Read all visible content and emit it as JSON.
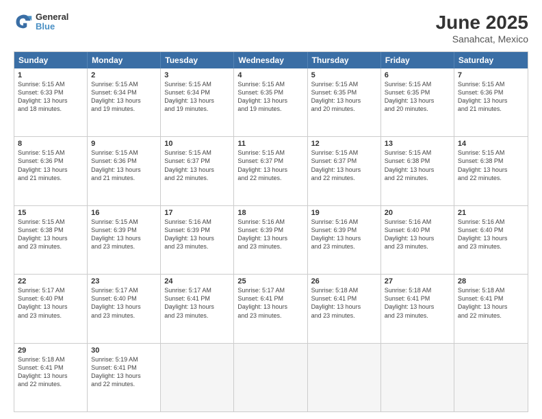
{
  "logo": {
    "line1": "General",
    "line2": "Blue"
  },
  "title": "June 2025",
  "subtitle": "Sanahcat, Mexico",
  "weekdays": [
    "Sunday",
    "Monday",
    "Tuesday",
    "Wednesday",
    "Thursday",
    "Friday",
    "Saturday"
  ],
  "weeks": [
    [
      {
        "day": "1",
        "text": "Sunrise: 5:15 AM\nSunset: 6:33 PM\nDaylight: 13 hours\nand 18 minutes."
      },
      {
        "day": "2",
        "text": "Sunrise: 5:15 AM\nSunset: 6:34 PM\nDaylight: 13 hours\nand 19 minutes."
      },
      {
        "day": "3",
        "text": "Sunrise: 5:15 AM\nSunset: 6:34 PM\nDaylight: 13 hours\nand 19 minutes."
      },
      {
        "day": "4",
        "text": "Sunrise: 5:15 AM\nSunset: 6:35 PM\nDaylight: 13 hours\nand 19 minutes."
      },
      {
        "day": "5",
        "text": "Sunrise: 5:15 AM\nSunset: 6:35 PM\nDaylight: 13 hours\nand 20 minutes."
      },
      {
        "day": "6",
        "text": "Sunrise: 5:15 AM\nSunset: 6:35 PM\nDaylight: 13 hours\nand 20 minutes."
      },
      {
        "day": "7",
        "text": "Sunrise: 5:15 AM\nSunset: 6:36 PM\nDaylight: 13 hours\nand 21 minutes."
      }
    ],
    [
      {
        "day": "8",
        "text": "Sunrise: 5:15 AM\nSunset: 6:36 PM\nDaylight: 13 hours\nand 21 minutes."
      },
      {
        "day": "9",
        "text": "Sunrise: 5:15 AM\nSunset: 6:36 PM\nDaylight: 13 hours\nand 21 minutes."
      },
      {
        "day": "10",
        "text": "Sunrise: 5:15 AM\nSunset: 6:37 PM\nDaylight: 13 hours\nand 22 minutes."
      },
      {
        "day": "11",
        "text": "Sunrise: 5:15 AM\nSunset: 6:37 PM\nDaylight: 13 hours\nand 22 minutes."
      },
      {
        "day": "12",
        "text": "Sunrise: 5:15 AM\nSunset: 6:37 PM\nDaylight: 13 hours\nand 22 minutes."
      },
      {
        "day": "13",
        "text": "Sunrise: 5:15 AM\nSunset: 6:38 PM\nDaylight: 13 hours\nand 22 minutes."
      },
      {
        "day": "14",
        "text": "Sunrise: 5:15 AM\nSunset: 6:38 PM\nDaylight: 13 hours\nand 22 minutes."
      }
    ],
    [
      {
        "day": "15",
        "text": "Sunrise: 5:15 AM\nSunset: 6:38 PM\nDaylight: 13 hours\nand 23 minutes."
      },
      {
        "day": "16",
        "text": "Sunrise: 5:15 AM\nSunset: 6:39 PM\nDaylight: 13 hours\nand 23 minutes."
      },
      {
        "day": "17",
        "text": "Sunrise: 5:16 AM\nSunset: 6:39 PM\nDaylight: 13 hours\nand 23 minutes."
      },
      {
        "day": "18",
        "text": "Sunrise: 5:16 AM\nSunset: 6:39 PM\nDaylight: 13 hours\nand 23 minutes."
      },
      {
        "day": "19",
        "text": "Sunrise: 5:16 AM\nSunset: 6:39 PM\nDaylight: 13 hours\nand 23 minutes."
      },
      {
        "day": "20",
        "text": "Sunrise: 5:16 AM\nSunset: 6:40 PM\nDaylight: 13 hours\nand 23 minutes."
      },
      {
        "day": "21",
        "text": "Sunrise: 5:16 AM\nSunset: 6:40 PM\nDaylight: 13 hours\nand 23 minutes."
      }
    ],
    [
      {
        "day": "22",
        "text": "Sunrise: 5:17 AM\nSunset: 6:40 PM\nDaylight: 13 hours\nand 23 minutes."
      },
      {
        "day": "23",
        "text": "Sunrise: 5:17 AM\nSunset: 6:40 PM\nDaylight: 13 hours\nand 23 minutes."
      },
      {
        "day": "24",
        "text": "Sunrise: 5:17 AM\nSunset: 6:41 PM\nDaylight: 13 hours\nand 23 minutes."
      },
      {
        "day": "25",
        "text": "Sunrise: 5:17 AM\nSunset: 6:41 PM\nDaylight: 13 hours\nand 23 minutes."
      },
      {
        "day": "26",
        "text": "Sunrise: 5:18 AM\nSunset: 6:41 PM\nDaylight: 13 hours\nand 23 minutes."
      },
      {
        "day": "27",
        "text": "Sunrise: 5:18 AM\nSunset: 6:41 PM\nDaylight: 13 hours\nand 23 minutes."
      },
      {
        "day": "28",
        "text": "Sunrise: 5:18 AM\nSunset: 6:41 PM\nDaylight: 13 hours\nand 22 minutes."
      }
    ],
    [
      {
        "day": "29",
        "text": "Sunrise: 5:18 AM\nSunset: 6:41 PM\nDaylight: 13 hours\nand 22 minutes."
      },
      {
        "day": "30",
        "text": "Sunrise: 5:19 AM\nSunset: 6:41 PM\nDaylight: 13 hours\nand 22 minutes."
      },
      {
        "day": "",
        "text": "",
        "empty": true
      },
      {
        "day": "",
        "text": "",
        "empty": true
      },
      {
        "day": "",
        "text": "",
        "empty": true
      },
      {
        "day": "",
        "text": "",
        "empty": true
      },
      {
        "day": "",
        "text": "",
        "empty": true
      }
    ]
  ]
}
